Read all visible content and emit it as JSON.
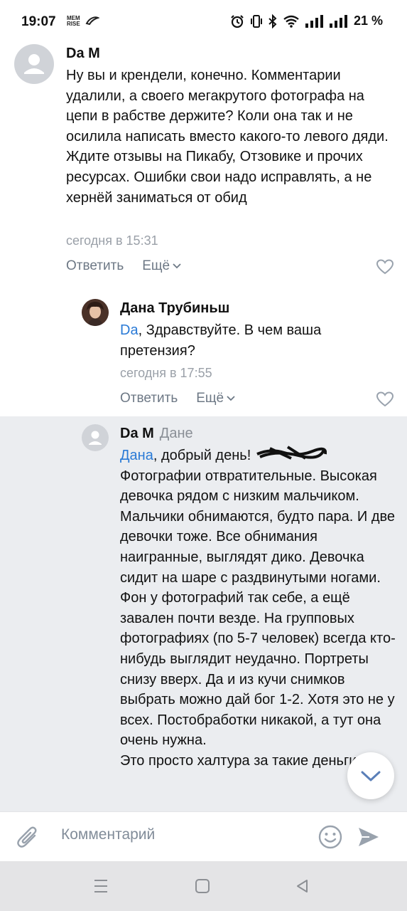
{
  "status_bar": {
    "time": "19:07",
    "app_icon_1": "MEM RISE",
    "battery": "21 %"
  },
  "comments": [
    {
      "author": "Da M",
      "text": "Ну вы и крендели, конечно. Комментарии удалили, а своего мегакрутого фотографа на цепи в рабстве держите? Коли она так и не осилила написать вместо какого-то левого дяди. Ждите отзывы на Пикабу, Отзовике и прочих ресурсах. Ошибки свои надо исправлять, а не хернёй заниматься от обид",
      "time": "сегодня в 15:31",
      "reply_label": "Ответить",
      "more_label": "Ещё"
    },
    {
      "author": "Дана Трубиньш",
      "mention": "Da",
      "text": ", Здравствуйте. В чем ваша претензия?",
      "time": "сегодня в 17:55",
      "reply_label": "Ответить",
      "more_label": "Ещё"
    },
    {
      "author": "Da M",
      "reply_to": "Дане",
      "mention": "Дана",
      "text": ", добрый день!",
      "text_lines": "Фотографии отвратительные. Высокая девочка рядом с низким мальчиком. Мальчики обнимаются, будто пара. И две девочки тоже. Все обнимания наигранные, выглядят дико. Девочка сидит на шаре с раздвинутыми ногами. Фон у фотографий так себе, а ещё завален почти везде. На групповых фотографиях (по 5-7 человек) всегда кто-нибудь выглядит неудачно. Портреты снизу вверх. Да и из кучи снимков выбрать можно дай бог 1-2. Хотя это не у всех. Постобработки никакой, а тут она очень нужна.",
      "text_last": "Это просто халтура за такие деньги."
    }
  ],
  "composer": {
    "placeholder": "Комментарий"
  },
  "icons": {
    "attach": "paperclip-icon",
    "emoji": "emoji-icon",
    "send": "send-icon",
    "scroll": "chevron-down-icon",
    "like": "heart-icon"
  },
  "colors": {
    "mention": "#2a7ad6",
    "highlight_bg": "#ebedf0",
    "secondary_text": "#6d7885"
  }
}
